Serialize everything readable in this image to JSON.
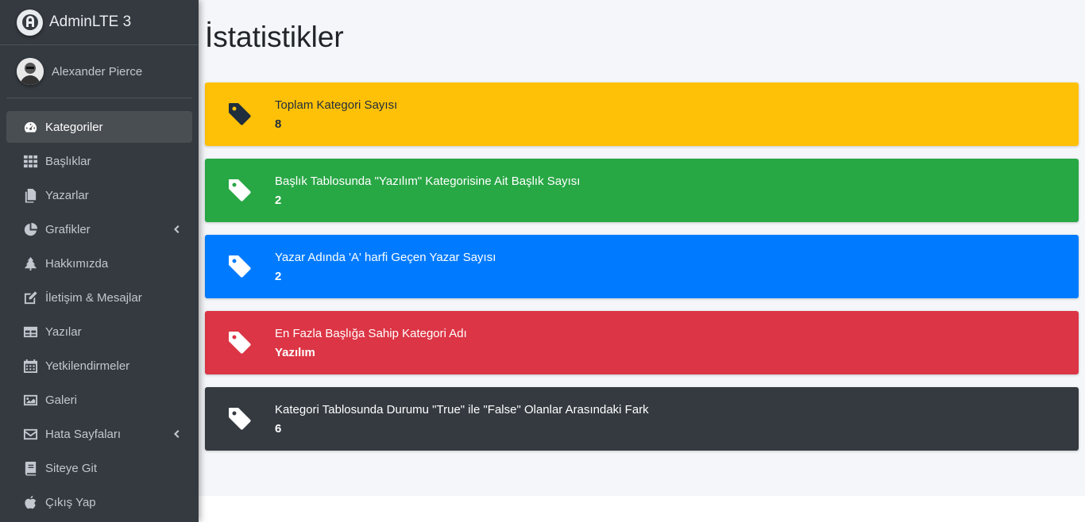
{
  "brand": {
    "title": "AdminLTE 3"
  },
  "user": {
    "name": "Alexander Pierce"
  },
  "sidebar": {
    "items": [
      {
        "label": "Kategoriler",
        "icon": "tachometer-icon",
        "active": true
      },
      {
        "label": "Başlıklar",
        "icon": "grid-icon"
      },
      {
        "label": "Yazarlar",
        "icon": "copy-icon"
      },
      {
        "label": "Grafikler",
        "icon": "pie-chart-icon",
        "has_submenu": true
      },
      {
        "label": "Hakkımızda",
        "icon": "tree-icon"
      },
      {
        "label": "İletişim & Mesajlar",
        "icon": "edit-icon"
      },
      {
        "label": "Yazılar",
        "icon": "table-icon"
      },
      {
        "label": "Yetkilendirmeler",
        "icon": "calendar-icon"
      },
      {
        "label": "Galeri",
        "icon": "image-icon"
      },
      {
        "label": "Hata Sayfaları",
        "icon": "envelope-icon",
        "has_submenu": true
      },
      {
        "label": "Siteye Git",
        "icon": "book-icon"
      },
      {
        "label": "Çıkış Yap",
        "icon": "apple-icon"
      }
    ]
  },
  "page": {
    "title": "İstatistikler"
  },
  "stats": [
    {
      "label": "Toplam Kategori Sayısı",
      "value": "8",
      "color": "#ffc107",
      "text_color": "#1f2d3d",
      "icon": "tag-icon"
    },
    {
      "label": "Başlık Tablosunda \"Yazılım\" Kategorisine Ait Başlık Sayısı",
      "value": "2",
      "color": "#28a745",
      "text_color": "#ffffff",
      "icon": "tag-icon"
    },
    {
      "label": "Yazar Adında 'A' harfi Geçen Yazar Sayısı",
      "value": "2",
      "color": "#007bff",
      "text_color": "#ffffff",
      "icon": "tag-icon"
    },
    {
      "label": "En Fazla Başlığa Sahip Kategori Adı",
      "value": "Yazılım",
      "color": "#dc3545",
      "text_color": "#ffffff",
      "icon": "tag-icon"
    },
    {
      "label": "Kategori Tablosunda Durumu \"True\" ile \"False\" Olanlar Arasındaki Fark",
      "value": "6",
      "color": "#343a40",
      "text_color": "#ffffff",
      "icon": "tag-icon"
    }
  ]
}
